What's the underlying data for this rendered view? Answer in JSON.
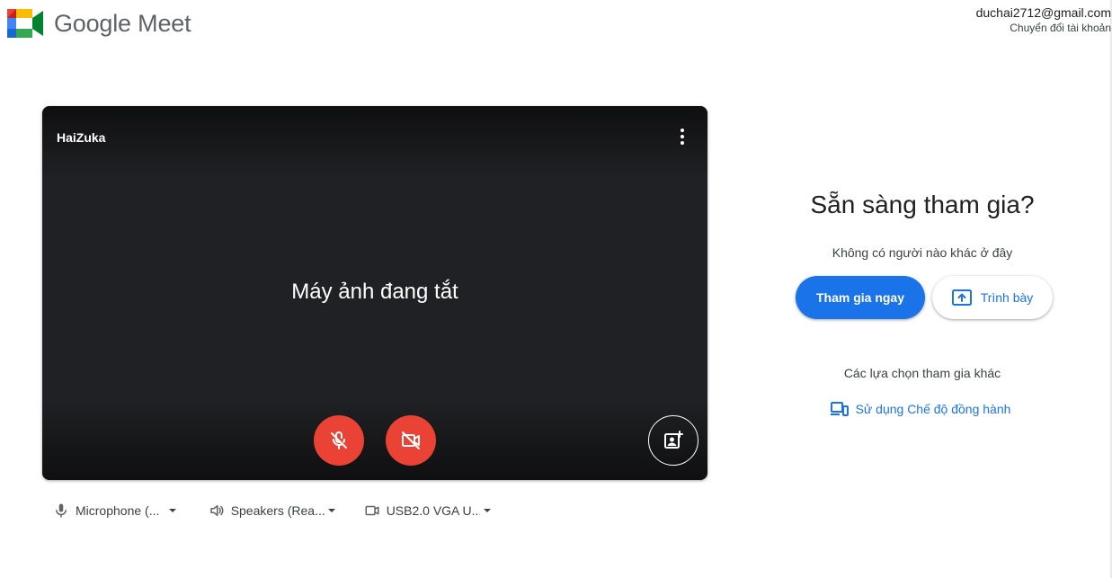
{
  "header": {
    "app_name": "Google Meet",
    "account_email": "duchai2712@gmail.com",
    "switch_account_label": "Chuyển đổi tài khoản"
  },
  "preview": {
    "user_name": "HaiZuka",
    "camera_off_text": "Máy ảnh đang tắt",
    "mic_state": "muted",
    "camera_state": "off"
  },
  "devices": {
    "microphone_label": "Microphone (...",
    "speakers_label": "Speakers (Rea...",
    "camera_label": "USB2.0 VGA U..."
  },
  "join_panel": {
    "title": "Sẵn sàng tham gia?",
    "status_text": "Không có người nào khác ở đây",
    "join_button_label": "Tham gia ngay",
    "present_button_label": "Trình bày",
    "other_options_label": "Các lựa chọn tham gia khác",
    "companion_mode_label": "Sử dụng Chế độ đồng hành"
  },
  "colors": {
    "accent": "#1a73e8",
    "danger": "#ea4335",
    "preview_bg": "#202124"
  },
  "icons": {
    "logo": "google-meet-logo",
    "more": "more-vert-icon",
    "mic_off": "mic-off-icon",
    "cam_off": "videocam-off-icon",
    "effects": "portrait-effects-icon",
    "mic": "mic-icon",
    "speaker": "volume-icon",
    "camera": "videocam-icon",
    "present": "present-to-all-icon",
    "companion": "devices-icon"
  }
}
